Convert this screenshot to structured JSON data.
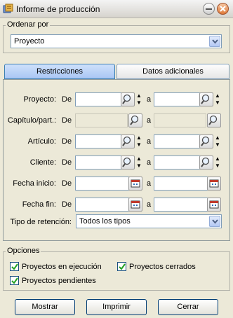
{
  "window": {
    "title": "Informe de producción"
  },
  "ordenar": {
    "legend": "Ordenar por",
    "value": "Proyecto"
  },
  "tabs": [
    {
      "label": "Restricciones",
      "active": true
    },
    {
      "label": "Datos adicionales",
      "active": false
    }
  ],
  "fields": {
    "de": "De",
    "a": "a",
    "proyecto": "Proyecto:",
    "capitulo": "Capítulo/part.:",
    "articulo": "Artículo:",
    "cliente": "Cliente:",
    "fecha_inicio": "Fecha inicio:",
    "fecha_fin": "Fecha fin:"
  },
  "tipo_retencion": {
    "label": "Tipo de retención:",
    "value": "Todos los tipos"
  },
  "opciones": {
    "legend": "Opciones",
    "items": [
      {
        "label": "Proyectos en ejecución",
        "checked": true
      },
      {
        "label": "Proyectos cerrados",
        "checked": true
      },
      {
        "label": "Proyectos pendientes",
        "checked": true
      }
    ]
  },
  "buttons": {
    "mostrar": "Mostrar",
    "imprimir": "Imprimir",
    "cerrar": "Cerrar"
  }
}
